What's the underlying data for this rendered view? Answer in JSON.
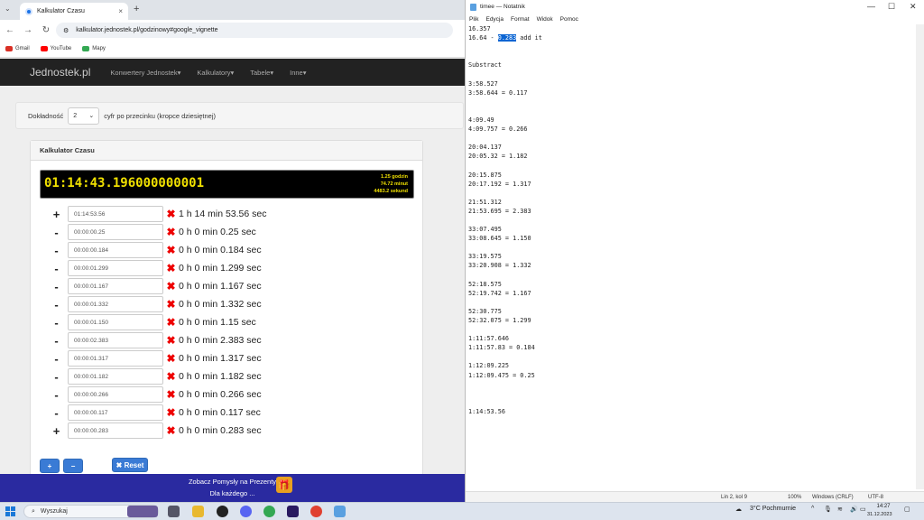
{
  "browser": {
    "tab_title": "Kalkulator Czasu",
    "tab_close": "×",
    "newtab": "+",
    "tab_menu": "⌄",
    "url": "kalkulator.jednostek.pl/godzinowy#google_vignette",
    "bookmarks": [
      {
        "label": "Gmail",
        "color": "#d93025"
      },
      {
        "label": "YouTube",
        "color": "#ff0000"
      },
      {
        "label": "Mapy",
        "color": "#34a853"
      }
    ]
  },
  "site": {
    "brand": "Jednostek.pl",
    "menu": [
      "Konwertery Jednostek▾",
      "Kalkulatory▾",
      "Tabele▾",
      "Inne▾"
    ],
    "precision_label": "Dokładność",
    "precision_value": "2",
    "precision_suffix": "cyfr po przecinku (kropce dziesiętnej)",
    "panel_title": "Kalkulator Czasu",
    "display_main": "01:14:43.196000000001",
    "display_side": [
      "1.25  godzin",
      "74.72  minut",
      "4483.2  sekund"
    ],
    "rows": [
      {
        "sign": "+",
        "value": "01:14:53.56",
        "result": "1 h 14 min 53.56 sec"
      },
      {
        "sign": "-",
        "value": "00:00:00.25",
        "result": "0 h 0 min 0.25 sec"
      },
      {
        "sign": "-",
        "value": "00:00:00.184",
        "result": "0 h 0 min 0.184 sec"
      },
      {
        "sign": "-",
        "value": "00:00:01.299",
        "result": "0 h 0 min 1.299 sec"
      },
      {
        "sign": "-",
        "value": "00:00:01.167",
        "result": "0 h 0 min 1.167 sec"
      },
      {
        "sign": "-",
        "value": "00:00:01.332",
        "result": "0 h 0 min 1.332 sec"
      },
      {
        "sign": "-",
        "value": "00:00:01.150",
        "result": "0 h 0 min 1.15 sec"
      },
      {
        "sign": "-",
        "value": "00:00:02.383",
        "result": "0 h 0 min 2.383 sec"
      },
      {
        "sign": "-",
        "value": "00:00:01.317",
        "result": "0 h 0 min 1.317 sec"
      },
      {
        "sign": "-",
        "value": "00:00:01.182",
        "result": "0 h 0 min 1.182 sec"
      },
      {
        "sign": "-",
        "value": "00:00:00.266",
        "result": "0 h 0 min 0.266 sec"
      },
      {
        "sign": "-",
        "value": "00:00:00.117",
        "result": "0 h 0 min 0.117 sec"
      },
      {
        "sign": "+",
        "value": "00:00:00.283",
        "result": "0 h 0 min 0.283 sec"
      }
    ],
    "add_label": "+",
    "sub_label": "−",
    "reset_label": "✖ Reset",
    "promo_line1": "Zobacz Pomysły na Prezenty",
    "promo_line2": "Dla każdego ..."
  },
  "notepad": {
    "title": "timee — Notatnik",
    "menu": [
      "Plik",
      "Edycja",
      "Format",
      "Widok",
      "Pomoc"
    ],
    "line1": "16.357",
    "line2_pre": "16.64 - ",
    "line2_sel": "0.283",
    "line2_post": " add it",
    "body": "\n\nSubstract\n\n3:58.527\n3:58.644 = 0.117\n\n\n4:09.49\n4:09.757 = 0.266\n\n20:04.137\n20:05.32 = 1.182\n\n20:15.875\n20:17.192 = 1.317\n\n21:51.312\n21:53.695 = 2.383\n\n33:07.495\n33:08.645 = 1.150\n\n33:19.575\n33:20.908 = 1.332\n\n52:18.575\n52:19.742 = 1.167\n\n52:30.775\n52:32.075 = 1.299\n\n1:11:57.646\n1:11:57.83 = 0.184\n\n1:12:09.225\n1:12:09.475 = 0.25\n\n\n\n1:14:53.56",
    "status": {
      "pos": "Lin 2, kol 9",
      "zoom": "100%",
      "eol": "Windows (CRLF)",
      "enc": "UTF-8"
    }
  },
  "taskbar": {
    "search": "Wyszukaj",
    "weather": "3°C  Pochmurnie",
    "time": "14:27",
    "date": "31.12.2023"
  }
}
